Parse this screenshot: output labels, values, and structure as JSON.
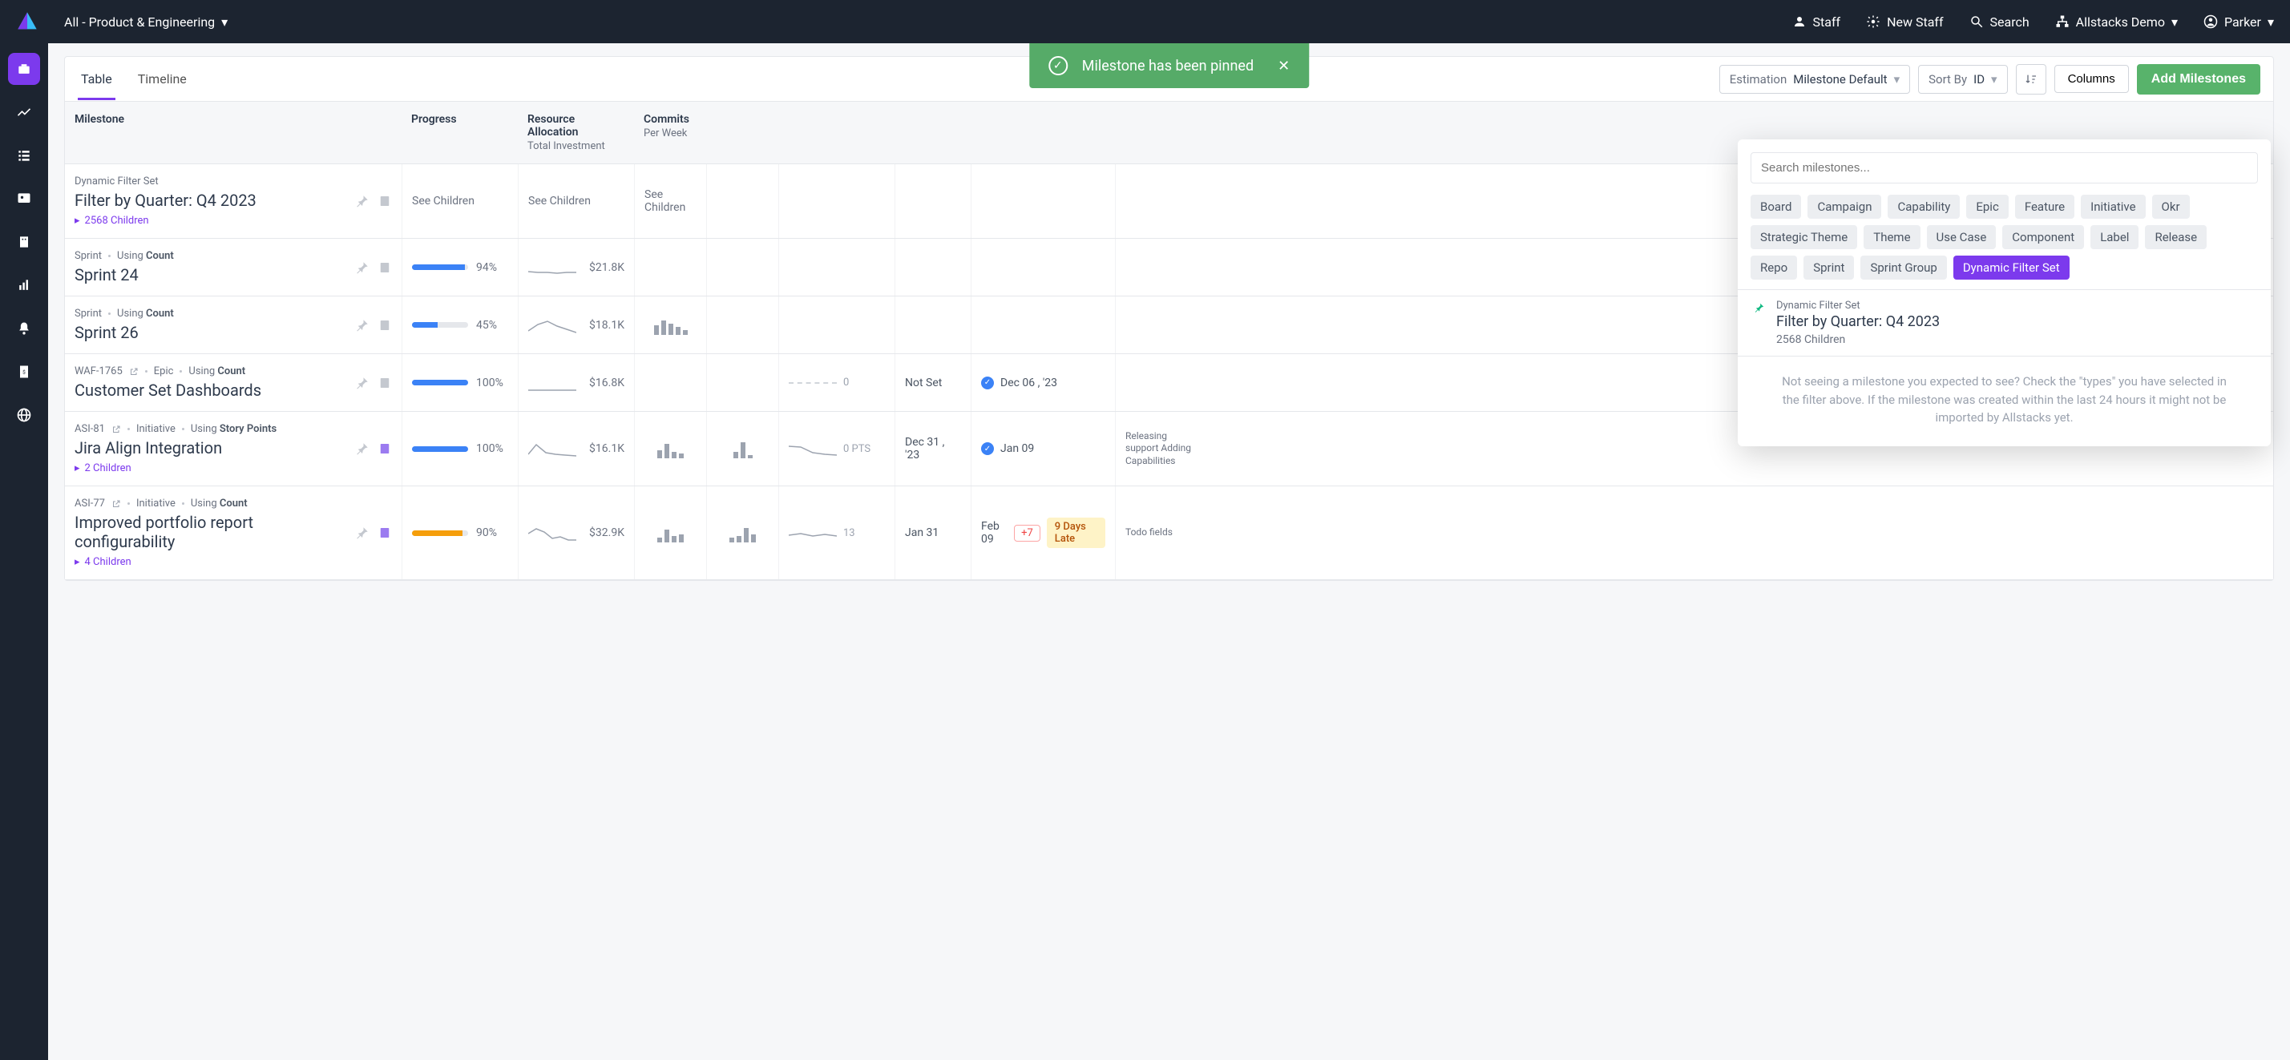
{
  "topnav": {
    "team": "All - Product & Engineering",
    "items": {
      "staff": "Staff",
      "new_staff": "New Staff",
      "search": "Search",
      "demo": "Allstacks Demo",
      "user": "Parker"
    }
  },
  "toast": {
    "message": "Milestone has been pinned"
  },
  "toolbar": {
    "tabs": {
      "table": "Table",
      "timeline": "Timeline"
    },
    "estimation_label": "Estimation",
    "estimation_value": "Milestone Default",
    "sort_label": "Sort By",
    "sort_value": "ID",
    "columns": "Columns",
    "add": "Add Milestones"
  },
  "columns": {
    "milestone": "Milestone",
    "progress": "Progress",
    "resource": "Resource Allocation",
    "resource_sub": "Total Investment",
    "commits": "Commits",
    "commits_sub": "Per Week"
  },
  "see_children": "See Children",
  "rows": [
    {
      "type": "Dynamic Filter Set",
      "name": "Filter by Quarter: Q4 2023",
      "children": "2568 Children",
      "see_children_cols": true
    },
    {
      "type": "Sprint",
      "using": "Count",
      "name": "Sprint 24",
      "progress": "94%",
      "progress_pct": 94,
      "resource": "$21.8K"
    },
    {
      "type": "Sprint",
      "using": "Count",
      "name": "Sprint 26",
      "progress": "45%",
      "progress_pct": 45,
      "resource": "$18.1K",
      "has_bars": true
    },
    {
      "key": "WAF-1765",
      "type": "Epic",
      "using": "Count",
      "name": "Customer Set Dashboards",
      "progress": "100%",
      "progress_pct": 100,
      "resource": "$16.8K",
      "scope": "0",
      "target": "Not Set",
      "projected": "Dec 06 , '23",
      "projected_check": true
    },
    {
      "key": "ASI-81",
      "type": "Initiative",
      "using": "Story Points",
      "name": "Jira Align Integration",
      "children": "2 Children",
      "progress": "100%",
      "progress_pct": 100,
      "resource": "$16.1K",
      "note_purple": true,
      "has_bars": true,
      "has_prs": true,
      "scope": "0 PTS",
      "scope_spark": true,
      "target": "Dec 31 , '23",
      "projected": "Jan 09",
      "projected_check": true,
      "summary": "Releasing support Adding Capabilities"
    },
    {
      "key": "ASI-77",
      "type": "Initiative",
      "using": "Count",
      "name": "Improved portfolio report configurability",
      "children": "4 Children",
      "progress": "90%",
      "progress_pct": 90,
      "progress_orange": true,
      "resource": "$32.9K",
      "note_purple": true,
      "has_bars": true,
      "has_prs": true,
      "scope": "13",
      "scope_spark": true,
      "target": "Jan 31",
      "projected": "Feb 09",
      "projected_badge": "+7",
      "projected_late": "9 Days Late",
      "summary": "Todo fields"
    }
  ],
  "popover": {
    "search_placeholder": "Search milestones...",
    "chips": [
      "Board",
      "Campaign",
      "Capability",
      "Epic",
      "Feature",
      "Initiative",
      "Okr",
      "Strategic Theme",
      "Theme",
      "Use Case",
      "Component",
      "Label",
      "Release",
      "Repo",
      "Sprint",
      "Sprint Group",
      "Dynamic Filter Set"
    ],
    "active_chip": "Dynamic Filter Set",
    "result": {
      "type": "Dynamic Filter Set",
      "title": "Filter by Quarter: Q4 2023",
      "children": "2568 Children"
    },
    "help": "Not seeing a milestone you expected to see? Check the \"types\" you have selected in the filter above. If the milestone was created within the last 24 hours it might not be imported by Allstacks yet."
  },
  "using_label": "Using "
}
